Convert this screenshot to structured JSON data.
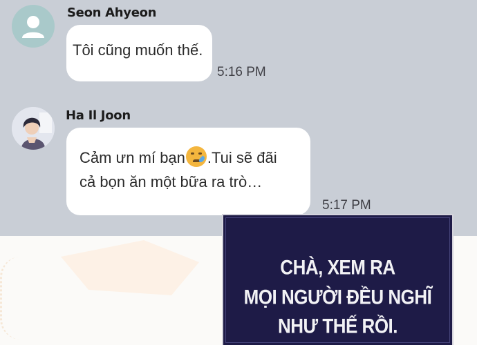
{
  "messages": [
    {
      "sender": "Seon Ahyeon",
      "avatar": "default-person-icon",
      "text": "Tôi cũng muốn thế.",
      "time": "5:16 PM"
    },
    {
      "sender": "Ha Il Joon",
      "avatar": "profile-photo",
      "text_before_emoji": "Cảm ưn mí bạn",
      "emoji": "crying-smiling-face-emoji",
      "text_after_emoji": ".Tui sẽ đãi",
      "text_line2": "cả bọn ăn một bữa ra trò…",
      "time": "5:17 PM"
    }
  ],
  "narration": {
    "line1": "CHÀ, XEM RA",
    "line2": "MỌI NGƯỜI ĐỀU NGHĨ",
    "line3": "NHƯ THẾ RỒI."
  },
  "colors": {
    "chat_background": "#c9ced6",
    "bubble": "#ffffff",
    "default_avatar": "#a9c9ca",
    "narration_box": "#1e1b47",
    "narration_text": "#f2f2f5"
  }
}
